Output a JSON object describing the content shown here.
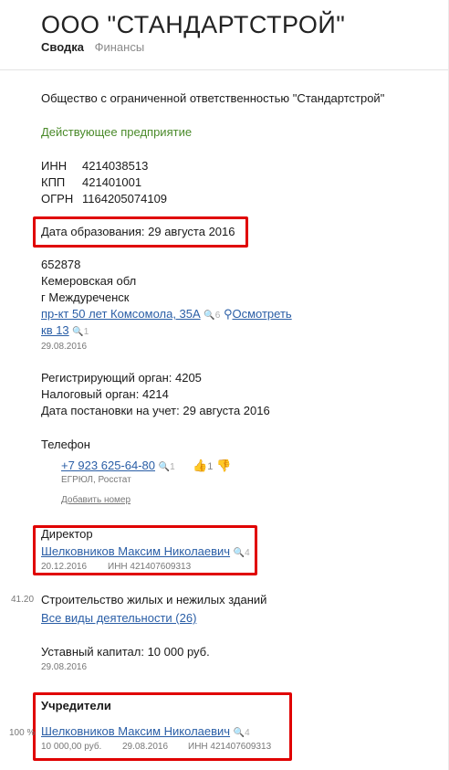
{
  "header": {
    "title": "ООО \"СТАНДАРТСТРОЙ\"",
    "tab_active": "Сводка",
    "tab_finance": "Финансы"
  },
  "info": {
    "full_name": "Общество с ограниченной ответственностью \"Стандартстрой\"",
    "status": "Действующее предприятие",
    "inn_label": "ИНН",
    "inn": "4214038513",
    "kpp_label": "КПП",
    "kpp": "421401001",
    "ogrn_label": "ОГРН",
    "ogrn": "1164205074109",
    "founded": "Дата образования: 29 августа 2016"
  },
  "address": {
    "zip": "652878",
    "region": "Кемеровская обл",
    "city": "г Междуреченск",
    "street": "пр-кт 50 лет Комсомола, 35А",
    "street_count": "6",
    "view": "Осмотреть",
    "apt": "кв 13",
    "apt_count": "1",
    "date": "29.08.2016"
  },
  "registration": {
    "reg_authority": "Регистрирующий орган: 4205",
    "tax_authority": "Налоговый орган: 4214",
    "reg_date": "Дата постановки на учет: 29 августа 2016"
  },
  "phone": {
    "label": "Телефон",
    "number": "+7 923 625-64-80",
    "count": "1",
    "likes": "1",
    "source": "ЕГРЮЛ, Росстат",
    "add": "Добавить номер"
  },
  "director": {
    "label": "Директор",
    "name": "Шелковников Максим Николаевич",
    "count": "4",
    "date": "20.12.2016",
    "inn": "ИНН 421407609313"
  },
  "activity": {
    "code": "41.20",
    "name": "Строительство жилых и нежилых зданий",
    "all": "Все виды деятельности (26)"
  },
  "capital": {
    "text": "Уставный капитал: 10 000 руб.",
    "date": "29.08.2016"
  },
  "founders": {
    "title": "Учредители",
    "share": "100 %",
    "name": "Шелковников Максим Николаевич",
    "count": "4",
    "amount": "10 000,00 руб.",
    "date": "29.08.2016",
    "inn": "ИНН 421407609313"
  },
  "colors": {
    "highlight": "#e00000",
    "link": "#2a5ea6",
    "status_green": "#4a8a2a"
  }
}
